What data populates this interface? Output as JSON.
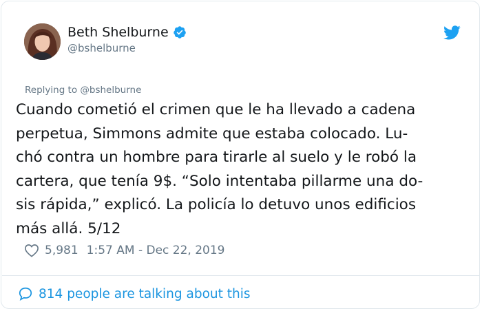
{
  "author": {
    "name": "Beth Shelburne",
    "handle": "@bshelburne"
  },
  "replying_to": "Replying to @bshelburne",
  "tweet": {
    "text": "Cuando cometió el crimen que le ha llevado a cadena\nperpetua, Simmons admite que estaba colocado. Lu-\nchó contra un hombre para tirarle al suelo y le robó la\ncartera, que tenía 9$. “Solo intentaba pillarme una do-\nsis rápida,” explicó. La policía lo detuvo unos edificios\nmás allá. 5/12"
  },
  "stats": {
    "likes": "5,981",
    "timestamp": "1:57 AM - Dec 22, 2019"
  },
  "footer": {
    "talking": "814 people are talking about this"
  },
  "icons": {
    "verified": "verified-badge-icon",
    "twitter": "twitter-bird-icon",
    "like": "heart-icon",
    "conversation": "speech-bubble-icon"
  },
  "colors": {
    "accent": "#1b95e0",
    "text": "#14171a",
    "muted": "#657786",
    "border": "#e1e8ed"
  }
}
